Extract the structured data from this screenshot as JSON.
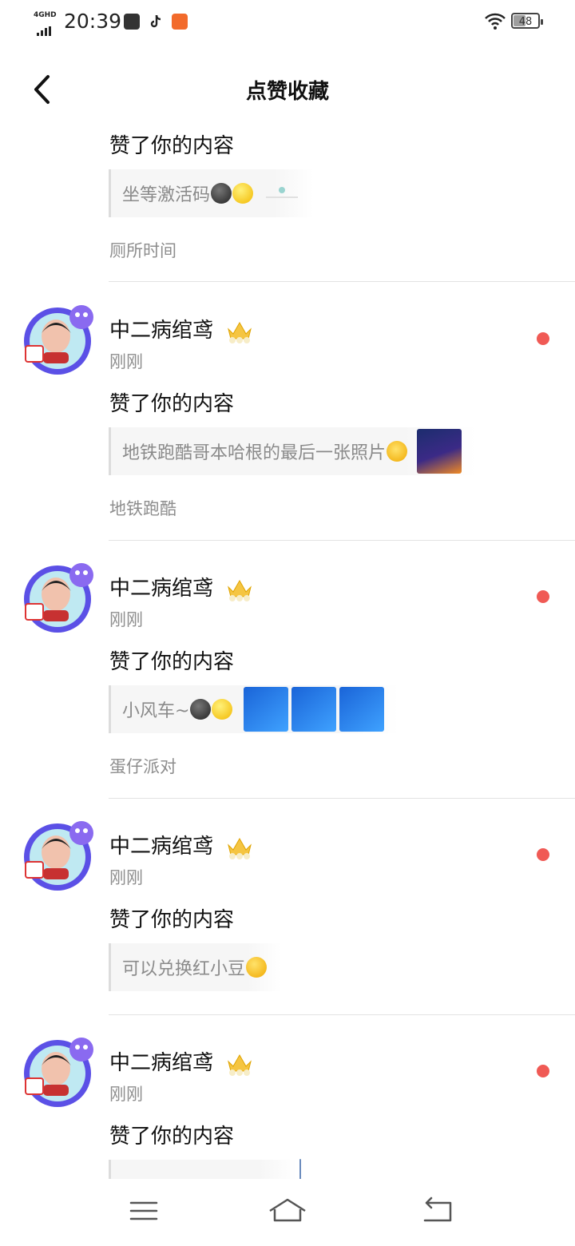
{
  "status_bar": {
    "network": "4GHD",
    "time": "20:39",
    "battery": "48",
    "battery_level": 0.48
  },
  "header": {
    "title": "点赞收藏"
  },
  "notifications": [
    {
      "action": "赞了你的内容",
      "quote": "坐等激活码",
      "tag": "厕所时间"
    },
    {
      "user": "中二病绾鸢",
      "time": "刚刚",
      "action": "赞了你的内容",
      "quote": "地铁跑酷哥本哈根的最后一张照片",
      "tag": "地铁跑酷",
      "unread": true
    },
    {
      "user": "中二病绾鸢",
      "time": "刚刚",
      "action": "赞了你的内容",
      "quote": "小风车~",
      "tag": "蛋仔派对",
      "unread": true
    },
    {
      "user": "中二病绾鸢",
      "time": "刚刚",
      "action": "赞了你的内容",
      "quote": "可以兑换红小豆",
      "unread": true
    },
    {
      "user": "中二病绾鸢",
      "time": "刚刚",
      "action": "赞了你的内容",
      "unread": true
    }
  ],
  "colors": {
    "unread_dot": "#f05a55",
    "accent_avatar_ring": "#6a5cff"
  },
  "icons": [
    "back-arrow-icon",
    "crown-icon",
    "menu-icon",
    "home-icon",
    "return-icon"
  ]
}
